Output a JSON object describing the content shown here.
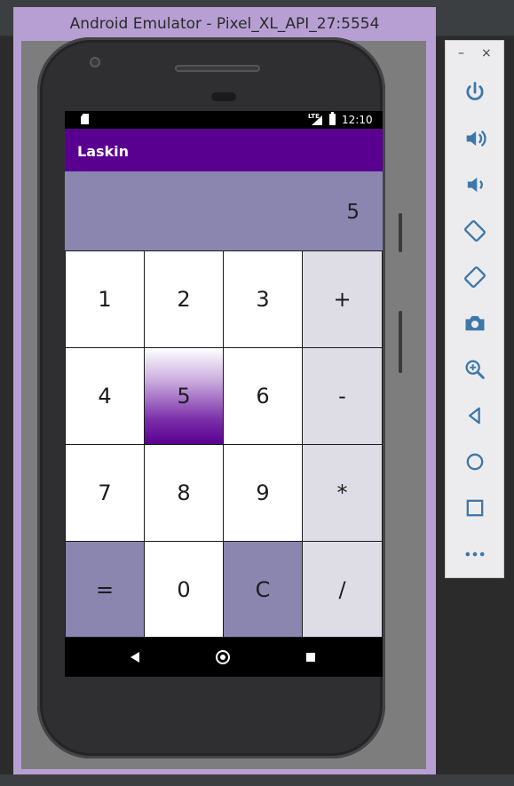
{
  "window": {
    "title": "Android Emulator - Pixel_XL_API_27:5554"
  },
  "status_bar": {
    "time": "12:10",
    "network": "LTE"
  },
  "app": {
    "title": "Laskin"
  },
  "display": {
    "value": "5"
  },
  "keys": [
    {
      "label": "1",
      "kind": "num"
    },
    {
      "label": "2",
      "kind": "num"
    },
    {
      "label": "3",
      "kind": "num"
    },
    {
      "label": "+",
      "kind": "op"
    },
    {
      "label": "4",
      "kind": "num"
    },
    {
      "label": "5",
      "kind": "num",
      "state": "pressed"
    },
    {
      "label": "6",
      "kind": "num"
    },
    {
      "label": "-",
      "kind": "op"
    },
    {
      "label": "7",
      "kind": "num"
    },
    {
      "label": "8",
      "kind": "num"
    },
    {
      "label": "9",
      "kind": "num"
    },
    {
      "label": "*",
      "kind": "op"
    },
    {
      "label": "=",
      "kind": "accent"
    },
    {
      "label": "0",
      "kind": "num"
    },
    {
      "label": "C",
      "kind": "accent"
    },
    {
      "label": "/",
      "kind": "op"
    }
  ],
  "side_panel": {
    "minimize": "–",
    "close": "×",
    "buttons": [
      "power-icon",
      "volume-up-icon",
      "volume-down-icon",
      "rotate-left-icon",
      "rotate-right-icon",
      "camera-icon",
      "zoom-icon",
      "back-icon",
      "home-icon",
      "overview-icon",
      "more-icon"
    ]
  },
  "colors": {
    "app_bar": "#5a0090",
    "display_bg": "#8a86b0",
    "operator_key": "#dedde6",
    "accent_key": "#8a86b0",
    "emulator_frame": "#b79fd3"
  }
}
